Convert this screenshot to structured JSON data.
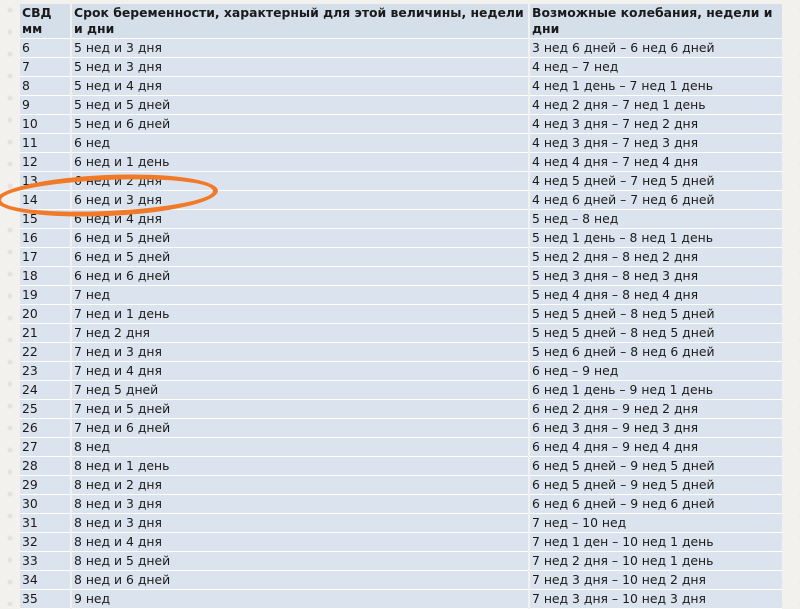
{
  "headers": [
    "СВД мм",
    "Срок беременности, характерный для этой величины, недели и дни",
    "Возможные колебания, недели и дни"
  ],
  "rows": [
    [
      "6",
      "5 нед и 3 дня",
      "3 нед 6 дней – 6 нед 6 дней"
    ],
    [
      "7",
      "5 нед и 3 дня",
      "4 нед – 7 нед"
    ],
    [
      "8",
      "5 нед и 4 дня",
      "4 нед 1 день – 7 нед 1 день"
    ],
    [
      "9",
      "5 нед и 5 дней",
      "4 нед 2 дня – 7 нед 1 день"
    ],
    [
      "10",
      "5 нед и 6 дней",
      "4 нед 3 дня – 7 нед 2 дня"
    ],
    [
      "11",
      "6 нед",
      "4 нед 3 дня – 7 нед 3 дня"
    ],
    [
      "12",
      "6 нед и 1 день",
      "4 нед 4 дня – 7 нед 4 дня"
    ],
    [
      "13",
      "6 нед и 2 дня",
      "4 нед 5 дней – 7 нед 5 дней"
    ],
    [
      "14",
      "6 нед и 3 дня",
      "4 нед 6 дней – 7 нед 6 дней"
    ],
    [
      "15",
      "6 нед и 4 дня",
      "5 нед – 8 нед"
    ],
    [
      "16",
      "6 нед и 5 дней",
      "5 нед 1 день – 8 нед 1 день"
    ],
    [
      "17",
      "6 нед и 5 дней",
      "5 нед 2 дня – 8 нед 2 дня"
    ],
    [
      "18",
      "6 нед и 6 дней",
      "5 нед 3 дня – 8 нед 3 дня"
    ],
    [
      "19",
      "7 нед",
      "5 нед 4 дня – 8 нед 4 дня"
    ],
    [
      "20",
      "7 нед и 1 день",
      "5 нед 5 дней – 8 нед 5 дней"
    ],
    [
      "21",
      "7 нед 2 дня",
      "5 нед 5 дней – 8 нед 5 дней"
    ],
    [
      "22",
      "7 нед и 3 дня",
      "5 нед 6 дней – 8 нед 6 дней"
    ],
    [
      "23",
      "7 нед и 4 дня",
      "6 нед – 9 нед"
    ],
    [
      "24",
      "7 нед 5 дней",
      "6 нед 1 день – 9 нед 1 день"
    ],
    [
      "25",
      "7 нед и 5 дней",
      "6 нед 2 дня – 9 нед 2 дня"
    ],
    [
      "26",
      "7 нед и 6 дней",
      "6 нед 3 дня – 9 нед 3 дня"
    ],
    [
      "27",
      "8 нед",
      "6 нед 4 дня – 9 нед 4 дня"
    ],
    [
      "28",
      "8 нед и 1 день",
      "6 нед 5 дней – 9 нед 5 дней"
    ],
    [
      "29",
      "8 нед и 2 дня",
      "6 нед 5 дней – 9 нед 5 дней"
    ],
    [
      "30",
      "8 нед и 3 дня",
      "6 нед 6 дней – 9 нед 6 дней"
    ],
    [
      "31",
      "8 нед и 3 дня",
      "7 нед – 10 нед"
    ],
    [
      "32",
      "8 нед и 4 дня",
      "7 нед 1 ден – 10 нед 1 день"
    ],
    [
      "33",
      "8 нед и 5 дней",
      "7 нед 2 дня – 10 нед 1 день"
    ],
    [
      "34",
      "8 нед и 6 дней",
      "7 нед 3 дня – 10 нед 2 дня"
    ],
    [
      "35",
      "9 нед",
      "7 нед 3 дня – 10 нед 3 дня"
    ]
  ],
  "highlight": {
    "row_value": "14",
    "color": "#f07a28"
  },
  "colors": {
    "header_bg": "#d4dfea",
    "row_bg": "#dbe4ee",
    "page_bg": "#f2f1ee"
  }
}
